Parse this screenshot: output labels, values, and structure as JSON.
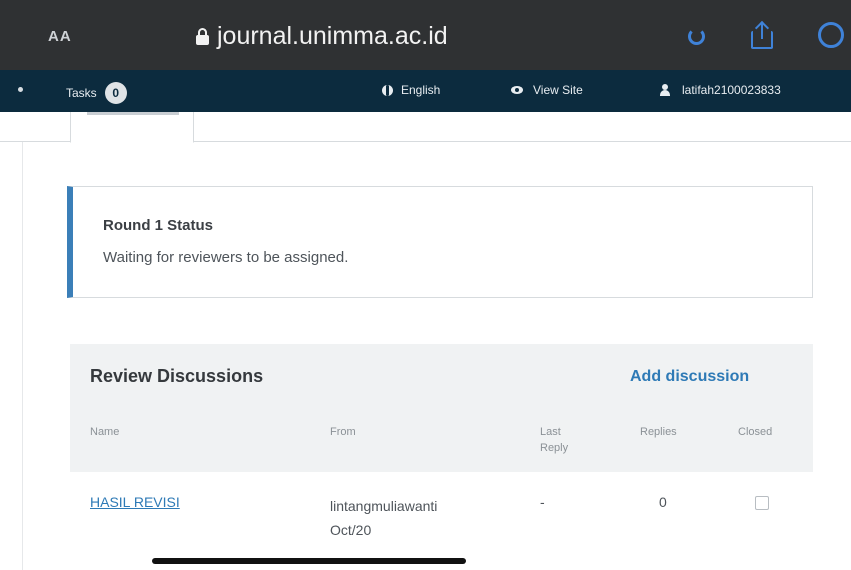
{
  "browser": {
    "left_label": "AA",
    "url": "journal.unimma.ac.id"
  },
  "nav": {
    "tasks_label": "Tasks",
    "tasks_count": "0",
    "language": "English",
    "view_site": "View Site",
    "user": "latifah2100023833"
  },
  "status": {
    "title": "Round 1 Status",
    "text": "Waiting for reviewers to be assigned."
  },
  "discussions": {
    "title": "Review Discussions",
    "add_label": "Add discussion",
    "columns": {
      "name": "Name",
      "from": "From",
      "last_reply_1": "Last",
      "last_reply_2": "Reply",
      "replies": "Replies",
      "closed": "Closed"
    },
    "rows": [
      {
        "name": "HASIL REVISI",
        "from_user": "lintangmuliawanti",
        "from_date": "Oct/20",
        "last_reply": "-",
        "replies": "0",
        "closed": false
      }
    ]
  },
  "colors": {
    "nav_bg": "#0c2b3e",
    "accent_blue": "#3b7fb8",
    "link_blue": "#2e7ab6",
    "browser_blue": "#3f82d8"
  },
  "icons": [
    "lock-icon",
    "reload-icon",
    "share-icon",
    "compass-icon",
    "globe-icon",
    "eye-icon",
    "user-icon"
  ]
}
